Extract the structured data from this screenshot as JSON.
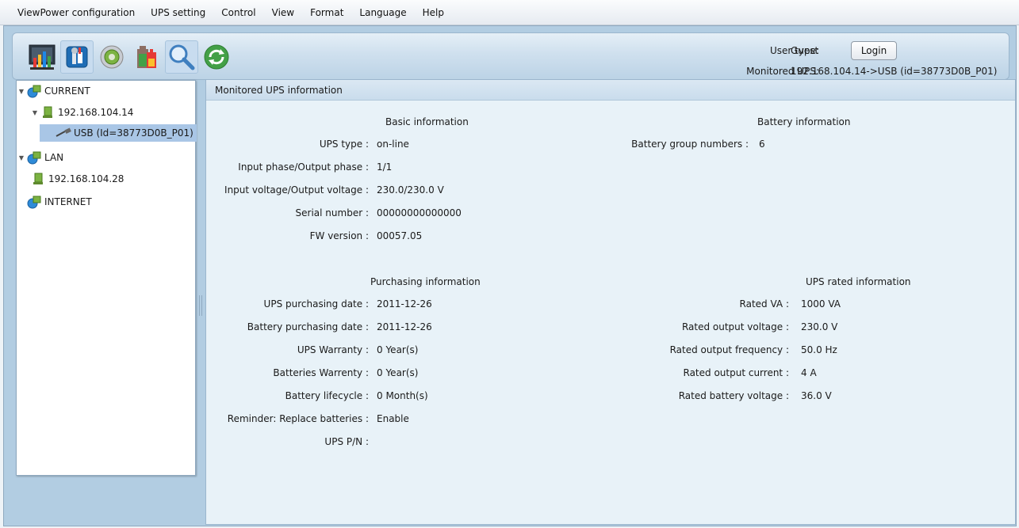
{
  "menu": [
    "ViewPower configuration",
    "UPS setting",
    "Control",
    "View",
    "Format",
    "Language",
    "Help"
  ],
  "toolbar": {
    "icons": [
      "monitor-chart-icon",
      "ups-settings-icon",
      "control-dial-icon",
      "battery-log-icon",
      "search-icon",
      "refresh-icon"
    ],
    "user_type_label": "User type:",
    "user_type_value": "Guest",
    "login_label": "Login",
    "monitored_ups_label": "Monitored UPS:",
    "monitored_ups_value": "192.168.104.14->USB (id=38773D0B_P01)"
  },
  "tree": {
    "current": "CURRENT",
    "current_host": "192.168.104.14",
    "current_usb": "USB (Id=38773D0B_P01)",
    "lan": "LAN",
    "lan_host": "192.168.104.28",
    "internet": "INTERNET"
  },
  "main": {
    "header": "Monitored UPS information",
    "basic": {
      "title": "Basic information",
      "rows": [
        {
          "label": "UPS type :",
          "value": "on-line"
        },
        {
          "label": "Input phase/Output phase :",
          "value": "1/1"
        },
        {
          "label": "Input voltage/Output voltage :",
          "value": "230.0/230.0 V"
        },
        {
          "label": "Serial number :",
          "value": "00000000000000"
        },
        {
          "label": "FW version :",
          "value": "00057.05"
        }
      ]
    },
    "battery": {
      "title": "Battery information",
      "rows": [
        {
          "label": "Battery group numbers :",
          "value": "6"
        }
      ]
    },
    "purchasing": {
      "title": "Purchasing information",
      "rows": [
        {
          "label": "UPS purchasing date :",
          "value": "2011-12-26"
        },
        {
          "label": "Battery purchasing date :",
          "value": "2011-12-26"
        },
        {
          "label": "UPS Warranty :",
          "value": "0 Year(s)"
        },
        {
          "label": "Batteries Warrenty :",
          "value": "0 Year(s)"
        },
        {
          "label": "Battery lifecycle :",
          "value": "0 Month(s)"
        },
        {
          "label": "Reminder: Replace batteries :",
          "value": "Enable"
        },
        {
          "label": "UPS P/N :",
          "value": ""
        }
      ]
    },
    "rated": {
      "title": "UPS rated information",
      "rows": [
        {
          "label": "Rated VA :",
          "value": "1000 VA"
        },
        {
          "label": "Rated output voltage :",
          "value": "230.0 V"
        },
        {
          "label": "Rated output frequency :",
          "value": "50.0 Hz"
        },
        {
          "label": "Rated output current :",
          "value": "4 A"
        },
        {
          "label": "Rated battery voltage :",
          "value": "36.0 V"
        }
      ]
    }
  }
}
